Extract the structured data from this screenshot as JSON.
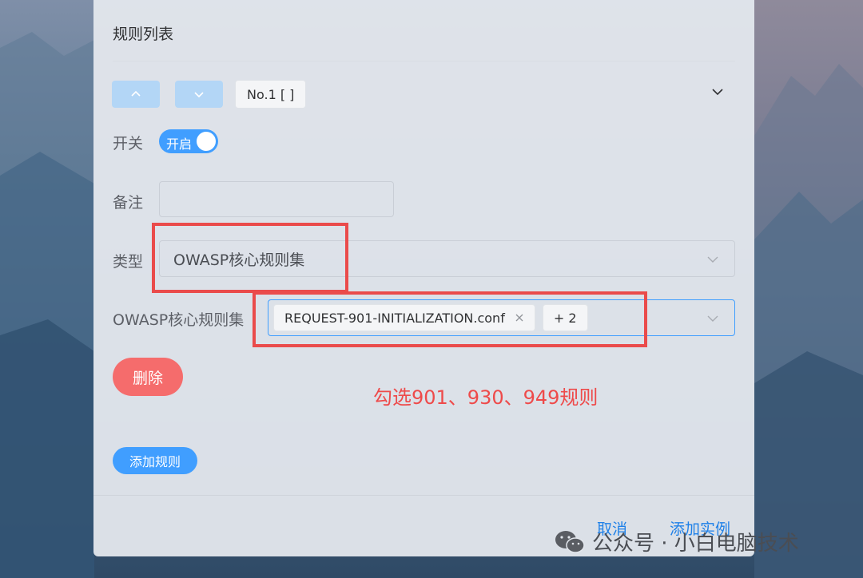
{
  "panel": {
    "title": "规则列表",
    "order": {
      "up_icon": "chevron-up-icon",
      "down_icon": "chevron-down-icon"
    },
    "rule_tag": "No.1 [ ]"
  },
  "form": {
    "switch": {
      "label": "开关",
      "state_text": "开启",
      "on": true,
      "color": "#409eff"
    },
    "remark": {
      "label": "备注",
      "value": "",
      "placeholder": ""
    },
    "type": {
      "label": "类型",
      "value": "OWASP核心规则集"
    },
    "ruleset": {
      "label": "OWASP核心规则集",
      "tags": [
        "REQUEST-901-INITIALIZATION.conf"
      ],
      "more": "+ 2"
    },
    "delete_label": "删除",
    "delete_color": "#f56c6c"
  },
  "add_rule_label": "添加规则",
  "footer": {
    "cancel_label": "取消",
    "confirm_label": "添加实例"
  },
  "annotation": {
    "text": "勾选901、930、949规则",
    "color": "#ee4a4a"
  },
  "watermark": {
    "text": "公众号 · 小白电脑技术",
    "icon": "wechat-icon"
  }
}
